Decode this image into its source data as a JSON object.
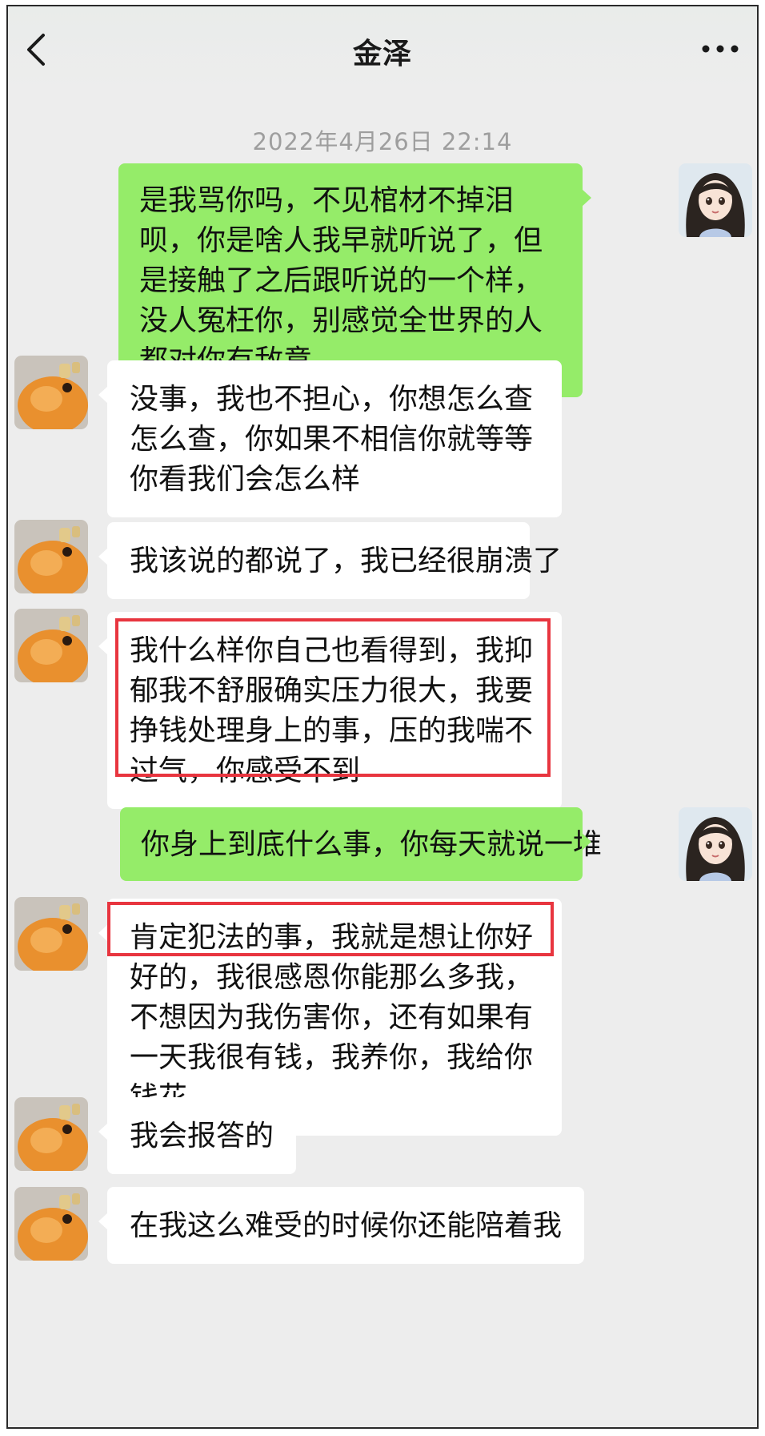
{
  "header": {
    "title": "金泽",
    "back_icon": "chevron-left-icon",
    "more_icon": "more-dots-icon"
  },
  "timestamp": "2022年4月26日 22:14",
  "colors": {
    "outgoing_bubble": "#95ec69",
    "incoming_bubble": "#ffffff",
    "background": "#ededed",
    "highlight": "#e8353f"
  },
  "messages": [
    {
      "side": "out",
      "text": "是我骂你吗，不见棺材不掉泪呗，你是啥人我早就听说了，但是接触了之后跟听说的一个样，没人冤枉你，别感觉全世界的人都对你有敌意"
    },
    {
      "side": "in",
      "text": "没事，我也不担心，你想怎么查怎么查，你如果不相信你就等等你看我们会怎么样"
    },
    {
      "side": "in",
      "text": "我该说的都说了，我已经很崩溃了"
    },
    {
      "side": "in",
      "text": "我什么样你自己也看得到，我抑郁我不舒服确实压力很大，我要挣钱处理身上的事，压的我喘不过气，你感受不到",
      "highlighted": true
    },
    {
      "side": "out",
      "text": "你身上到底什么事，你每天就说一堆"
    },
    {
      "side": "in",
      "text": "肯定犯法的事，我就是想让你好好的，我很感恩你能那么多我，不想因为我伤害你，还有如果有一天我很有钱，我养你，我给你钱花",
      "highlighted_first_line": true
    },
    {
      "side": "in",
      "text": "我会报答的"
    },
    {
      "side": "in",
      "text": "在我这么难受的时候你还能陪着我"
    }
  ],
  "avatars": {
    "self": "girl-avatar-icon",
    "contact": "cartoon-creature-avatar-icon"
  }
}
